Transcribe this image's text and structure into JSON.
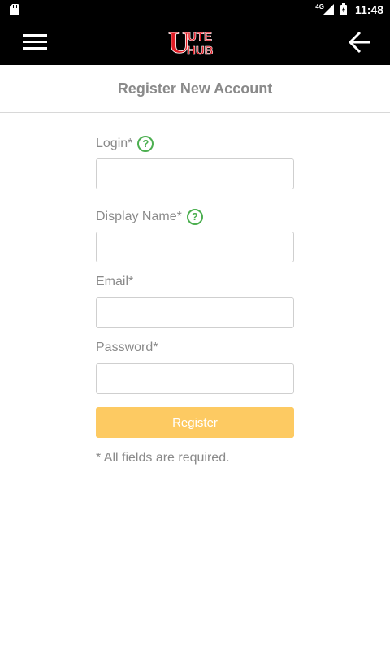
{
  "status_bar": {
    "network": "4G",
    "time": "11:48"
  },
  "app_bar": {
    "logo_text_top": "UTE",
    "logo_text_bottom": "HUB",
    "logo_letter": "U",
    "brand_color": "#e01b24"
  },
  "page": {
    "title": "Register New Account"
  },
  "form": {
    "login_label": "Login*",
    "display_name_label": "Display Name*",
    "email_label": "Email*",
    "password_label": "Password*",
    "login_value": "",
    "display_name_value": "",
    "email_value": "",
    "password_value": "",
    "help_glyph": "?",
    "register_label": "Register",
    "required_note": "* All fields are required."
  },
  "colors": {
    "accent_button": "#fdca62",
    "help_icon": "#4caf50",
    "label_text": "#8a8a8a"
  },
  "icons": {
    "menu": "hamburger-menu-icon",
    "back": "arrow-left-icon",
    "help": "question-circle-icon",
    "sd_card": "sd-card-icon",
    "signal": "signal-icon",
    "battery": "battery-charging-icon"
  }
}
